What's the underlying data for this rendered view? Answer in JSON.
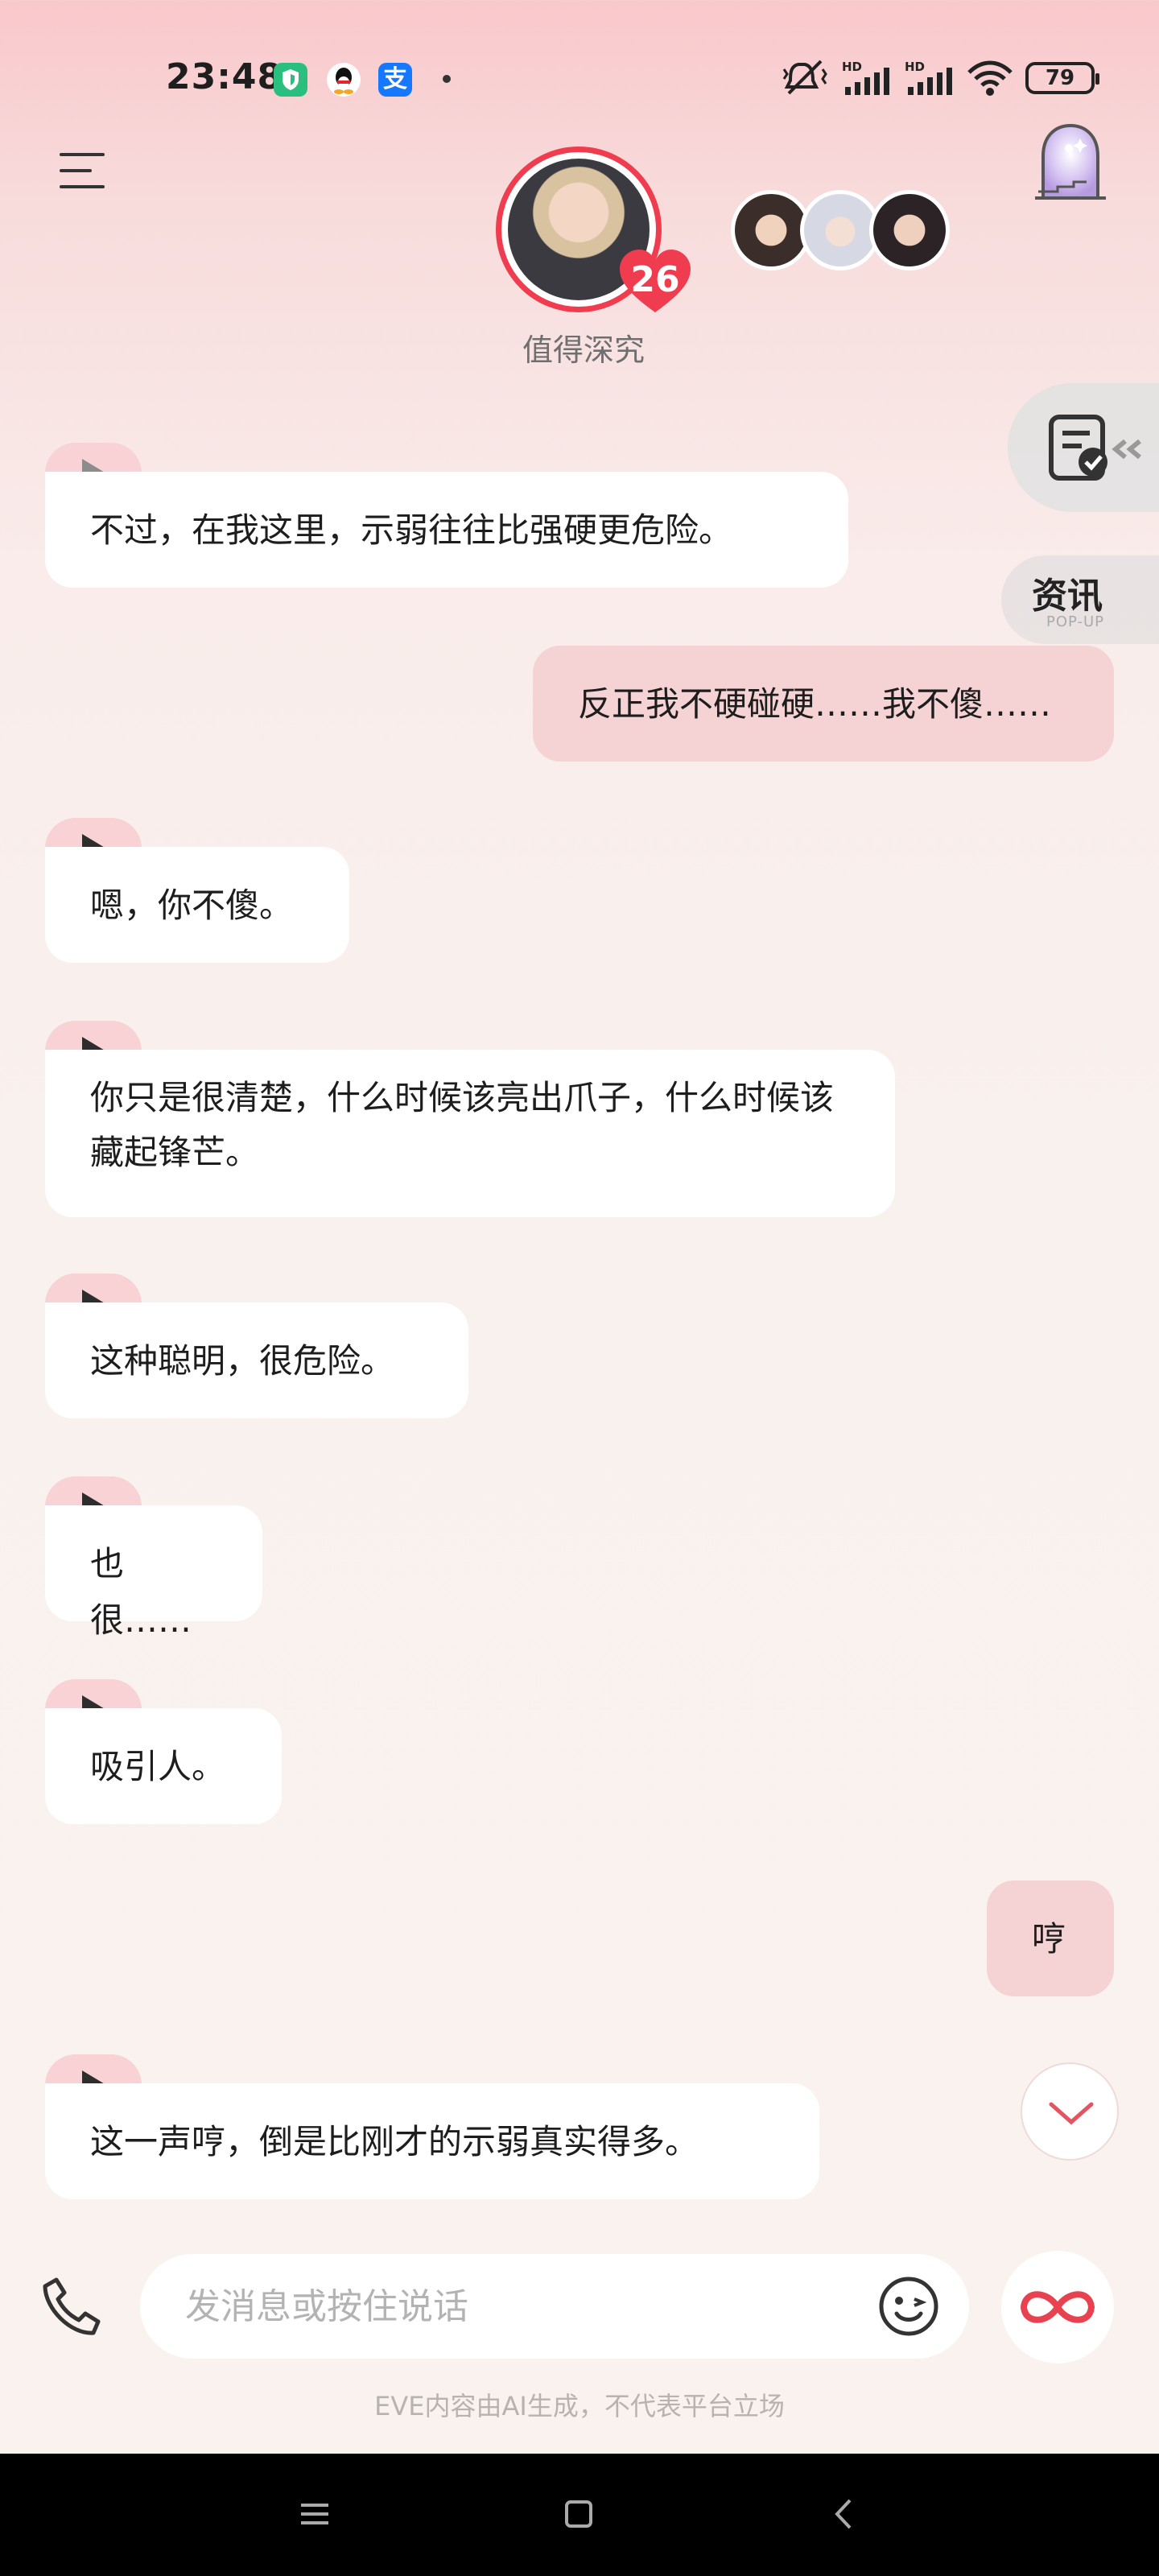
{
  "status_bar": {
    "time": "23:48",
    "alipay_glyph": "支",
    "battery": "79",
    "icons": [
      "mute-vibrate-icon",
      "hd-signal-icon",
      "hd-signal-icon",
      "wifi-icon",
      "battery-icon"
    ]
  },
  "header": {
    "affection_level": "26",
    "character_caption": "值得深究",
    "menu_icon": "hamburger-menu-icon",
    "door_icon": "door-portal-icon"
  },
  "side": {
    "task_icon": "task-clipboard-icon",
    "news_title": "资讯",
    "news_sub": "POP-UP"
  },
  "messages": [
    {
      "sender": "ai",
      "text": "不过，在我这里，示弱往往比强硬更危险。"
    },
    {
      "sender": "me",
      "text": "反正我不硬碰硬……我不傻……"
    },
    {
      "sender": "ai",
      "text": "嗯，你不傻。"
    },
    {
      "sender": "ai",
      "text": "你只是很清楚，什么时候该亮出爪子，什么时候该藏起锋芒。"
    },
    {
      "sender": "ai",
      "text": "这种聪明，很危险。"
    },
    {
      "sender": "ai",
      "text": "也很……"
    },
    {
      "sender": "ai",
      "text": "吸引人。"
    },
    {
      "sender": "me",
      "text": "哼"
    },
    {
      "sender": "ai",
      "text": "这一声哼，倒是比刚才的示弱真实得多。"
    }
  ],
  "composer": {
    "placeholder": "发消息或按住说话",
    "disclaimer": "EVE内容由AI生成，不代表平台立场"
  },
  "colors": {
    "accent": "#ef3d4f",
    "ai_bubble": "#ffffff",
    "me_bubble": "#f5d3d4",
    "play_tab": "#f8d2d4"
  }
}
